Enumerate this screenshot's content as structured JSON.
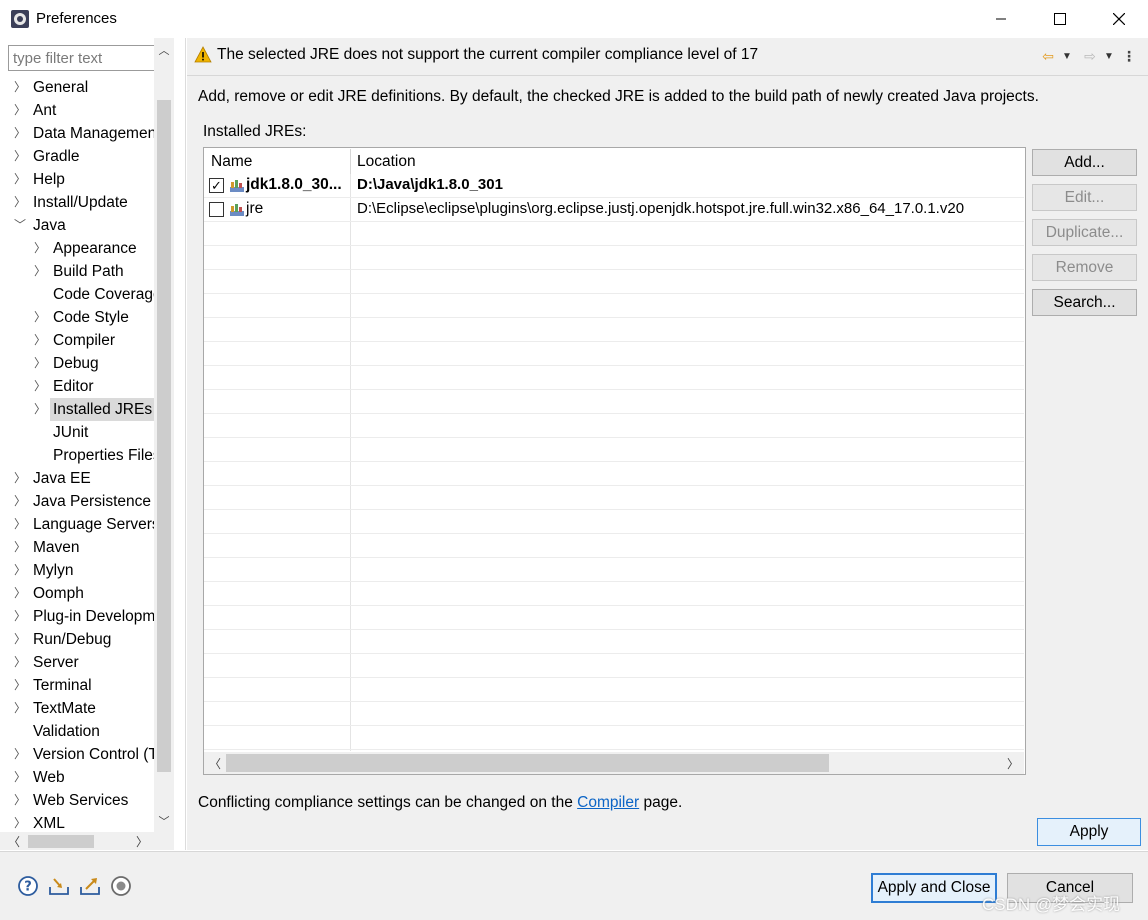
{
  "window": {
    "title": "Preferences",
    "minimize_glyph": "—",
    "maximize_glyph": "☐",
    "close_glyph": "✕"
  },
  "filter": {
    "placeholder": "type filter text",
    "value": ""
  },
  "tree": {
    "items": [
      {
        "label": "General",
        "level": 0,
        "expandable": true,
        "expanded": false
      },
      {
        "label": "Ant",
        "level": 0,
        "expandable": true,
        "expanded": false
      },
      {
        "label": "Data Management",
        "level": 0,
        "expandable": true,
        "expanded": false
      },
      {
        "label": "Gradle",
        "level": 0,
        "expandable": true,
        "expanded": false
      },
      {
        "label": "Help",
        "level": 0,
        "expandable": true,
        "expanded": false
      },
      {
        "label": "Install/Update",
        "level": 0,
        "expandable": true,
        "expanded": false
      },
      {
        "label": "Java",
        "level": 0,
        "expandable": true,
        "expanded": true
      },
      {
        "label": "Appearance",
        "level": 1,
        "expandable": true,
        "expanded": false
      },
      {
        "label": "Build Path",
        "level": 1,
        "expandable": true,
        "expanded": false
      },
      {
        "label": "Code Coverage",
        "level": 1,
        "expandable": false,
        "expanded": false
      },
      {
        "label": "Code Style",
        "level": 1,
        "expandable": true,
        "expanded": false
      },
      {
        "label": "Compiler",
        "level": 1,
        "expandable": true,
        "expanded": false
      },
      {
        "label": "Debug",
        "level": 1,
        "expandable": true,
        "expanded": false
      },
      {
        "label": "Editor",
        "level": 1,
        "expandable": true,
        "expanded": false
      },
      {
        "label": "Installed JREs",
        "level": 1,
        "expandable": true,
        "expanded": false,
        "selected": true
      },
      {
        "label": "JUnit",
        "level": 1,
        "expandable": false,
        "expanded": false
      },
      {
        "label": "Properties Files",
        "level": 1,
        "expandable": false,
        "expanded": false
      },
      {
        "label": "Java EE",
        "level": 0,
        "expandable": true,
        "expanded": false
      },
      {
        "label": "Java Persistence",
        "level": 0,
        "expandable": true,
        "expanded": false
      },
      {
        "label": "Language Servers",
        "level": 0,
        "expandable": true,
        "expanded": false
      },
      {
        "label": "Maven",
        "level": 0,
        "expandable": true,
        "expanded": false
      },
      {
        "label": "Mylyn",
        "level": 0,
        "expandable": true,
        "expanded": false
      },
      {
        "label": "Oomph",
        "level": 0,
        "expandable": true,
        "expanded": false
      },
      {
        "label": "Plug-in Development",
        "level": 0,
        "expandable": true,
        "expanded": false
      },
      {
        "label": "Run/Debug",
        "level": 0,
        "expandable": true,
        "expanded": false
      },
      {
        "label": "Server",
        "level": 0,
        "expandable": true,
        "expanded": false
      },
      {
        "label": "Terminal",
        "level": 0,
        "expandable": true,
        "expanded": false
      },
      {
        "label": "TextMate",
        "level": 0,
        "expandable": true,
        "expanded": false
      },
      {
        "label": "Validation",
        "level": 0,
        "expandable": false,
        "expanded": false
      },
      {
        "label": "Version Control (Team)",
        "level": 0,
        "expandable": true,
        "expanded": false
      },
      {
        "label": "Web",
        "level": 0,
        "expandable": true,
        "expanded": false
      },
      {
        "label": "Web Services",
        "level": 0,
        "expandable": true,
        "expanded": false
      },
      {
        "label": "XML",
        "level": 0,
        "expandable": true,
        "expanded": false
      }
    ]
  },
  "header": {
    "message": "The selected JRE does not support the current compiler compliance level of 17",
    "back_glyph": "⇦",
    "forward_glyph": "⇨",
    "menu_glyph": "▼",
    "more_glyph": "⋮"
  },
  "page": {
    "description": "Add, remove or edit JRE definitions. By default, the checked JRE is added to the build path of newly created Java projects.",
    "installed_label": "Installed JREs:",
    "table": {
      "columns": [
        "Name",
        "Location"
      ],
      "rows": [
        {
          "name": "jdk1.8.0_30...",
          "location": "D:\\Java\\jdk1.8.0_301",
          "checked": true,
          "bold": true
        },
        {
          "name": "jre",
          "location": "D:\\Eclipse\\eclipse\\plugins\\org.eclipse.justj.openjdk.hotspot.jre.full.win32.x86_64_17.0.1.v20",
          "checked": false,
          "bold": false
        }
      ]
    },
    "buttons": {
      "add": "Add...",
      "edit": "Edit...",
      "duplicate": "Duplicate...",
      "remove": "Remove",
      "search": "Search..."
    },
    "conflict_prefix": "Conflicting compliance settings can be changed on the ",
    "conflict_link": "Compiler",
    "conflict_suffix": " page.",
    "apply": "Apply"
  },
  "footer": {
    "apply_and_close": "Apply and Close",
    "cancel": "Cancel",
    "watermark": "CSDN @梦会实现"
  },
  "colors": {
    "link": "#0b64c6",
    "warning": "#f0b400",
    "back_arrow": "#e29a1e",
    "focus_border": "#2e7dd4"
  }
}
